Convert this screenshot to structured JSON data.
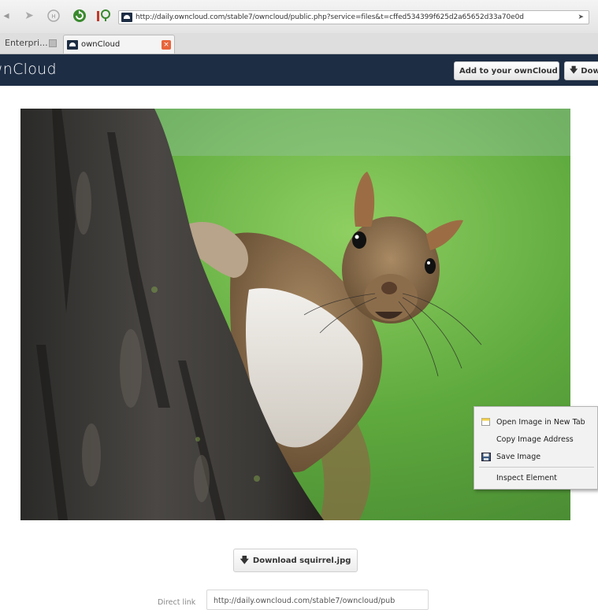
{
  "browser": {
    "url": "http://daily.owncloud.com/stable7/owncloud/public.php?service=files&t=cffed534399f625d2a65652d33a70e0d",
    "tabs": [
      {
        "label": "Enterpri..."
      },
      {
        "label": "ownCloud"
      }
    ]
  },
  "header": {
    "logo": "ownCloud",
    "add_button": "Add to your ownCloud",
    "download_button": "Dow"
  },
  "image": {
    "alt": "squirrel"
  },
  "context_menu": {
    "items": [
      {
        "label": "Open Image in New Tab",
        "icon": "new-tab-icon"
      },
      {
        "label": "Copy Image Address",
        "icon": ""
      },
      {
        "label": "Save Image",
        "icon": "save-icon"
      },
      {
        "label": "Inspect Element",
        "icon": ""
      }
    ]
  },
  "download": {
    "button_label": "Download squirrel.jpg",
    "direct_link_label": "Direct link",
    "direct_link_value": "http://daily.owncloud.com/stable7/owncloud/pub"
  },
  "colors": {
    "header_bg": "#1d2d44",
    "tab_close": "#e8643b"
  }
}
